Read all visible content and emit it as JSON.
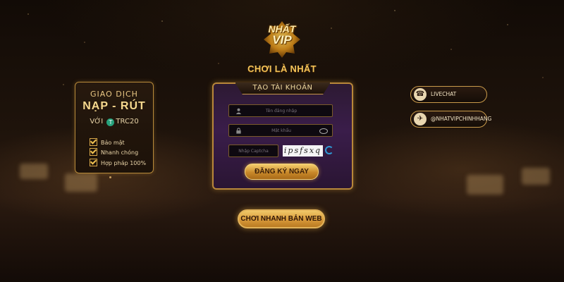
{
  "logo": {
    "line1": "NHẤT",
    "line2": "VIP"
  },
  "tagline": "CHƠI LÀ NHẤT",
  "promo": {
    "line1": "GIAO DỊCH",
    "line2": "NẠP - RÚT",
    "with_label": "VỚI",
    "currency": "TRC20",
    "currency_icon_glyph": "T",
    "features": [
      "Bảo mật",
      "Nhanh chóng",
      "Hợp pháp 100%"
    ]
  },
  "register": {
    "title": "TẠO TÀI KHOẢN",
    "username_placeholder": "Tên đăng nhập",
    "password_placeholder": "Mật khẩu",
    "captcha_placeholder": "Nhập Captcha",
    "captcha_text": "ipsfsxq",
    "submit_label": "ĐĂNG KÝ NGAY"
  },
  "play_web_label": "CHƠI NHANH BẢN WEB",
  "side": {
    "livechat_label": "LIVECHAT",
    "livechat_icon_glyph": "☎",
    "telegram_label": "@NHATVIPCHINHHANG",
    "telegram_icon_glyph": "✈"
  },
  "colors": {
    "gold": "#f2c35a",
    "panel_purple": "#3a1d4a",
    "button_gold": "#d89a3a"
  }
}
